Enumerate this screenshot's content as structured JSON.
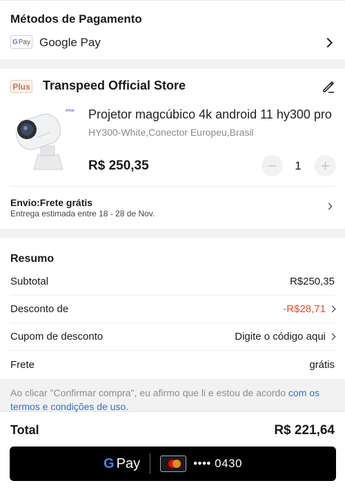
{
  "payment": {
    "title": "Métodos de Pagamento",
    "badge_g": "G",
    "badge_text": "Pay",
    "method_name": "Google Pay"
  },
  "store": {
    "badge": "Plus",
    "name": "Transpeed Official Store",
    "product": {
      "thumb_label": "White",
      "title": "Projetor magcúbico 4k android 11 hy300 pro",
      "variant": "HY300-White,Conector Europeu,Brasil",
      "price": "R$ 250,35",
      "qty_minus": "−",
      "qty": "1",
      "qty_plus": "+"
    },
    "shipping_title": "Envio:Frete grátis",
    "shipping_sub": "Entrega estimada entre 18 - 28 de Nov."
  },
  "summary": {
    "title": "Resumo",
    "rows": [
      {
        "label": "Subtotal",
        "value": "R$250,35"
      },
      {
        "label": "Desconto de",
        "value": "-R$28,71"
      },
      {
        "label": "Cupom de desconto",
        "value": "Digite o código aqui"
      },
      {
        "label": "Frete",
        "value": "grátis"
      }
    ]
  },
  "legal": {
    "text": "Ao clicar \"Confirmar compra\", eu afirmo que li e estou de acordo ",
    "link": "com os termos e condições de uso."
  },
  "bottom": {
    "total_label": "Total",
    "total_value": "R$ 221,64",
    "gpay_g": "G",
    "gpay_text": "Pay",
    "card_number": "•••• 0430"
  },
  "colors": {
    "discount": "#e34a2a",
    "link": "#2f6ed4",
    "store_badge": "#c7734b",
    "button_bg": "#000000"
  }
}
